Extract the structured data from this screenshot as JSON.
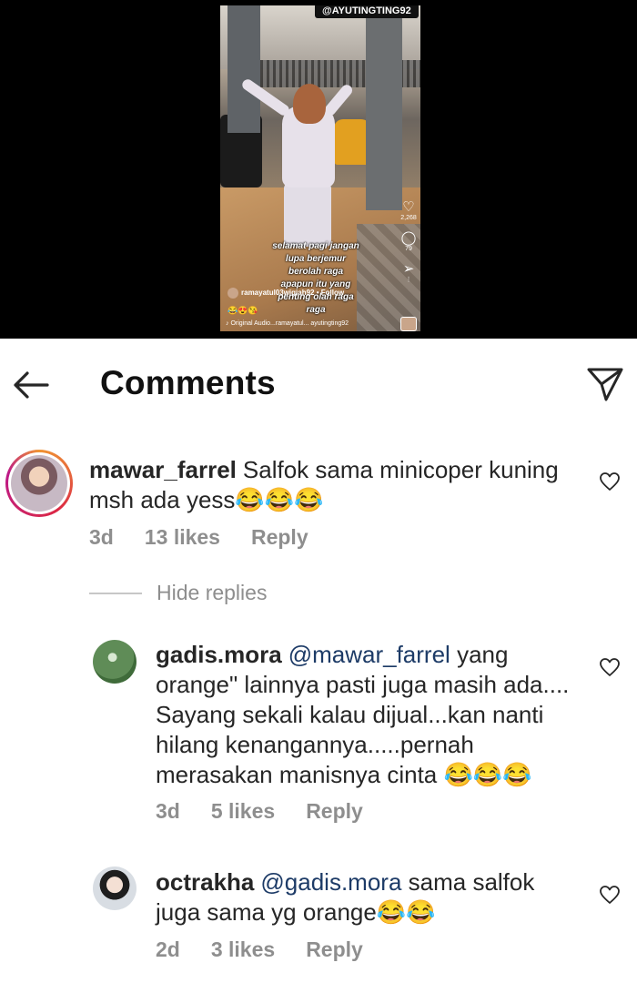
{
  "reel": {
    "handle": "@AYUTINGTING92",
    "caption_lines": [
      "selamat pagi jangan",
      "lupa berjemur",
      "berolah raga",
      "apapun itu yang",
      "penting olah raga",
      "raga"
    ],
    "like_count": "2,268",
    "comment_count": "79",
    "creator_line": "ramayatul03wigiah92 • Follow",
    "emojis": "😂😍😘",
    "audio_line": "Original Audio...ramayatul... ayutingting92"
  },
  "header": {
    "title": "Comments"
  },
  "comments": [
    {
      "username": "mawar_farrel",
      "mention": "",
      "text": "Salfok sama minicoper kuning msh ada yess😂😂😂",
      "time": "3d",
      "likes": "13 likes",
      "reply": "Reply"
    },
    {
      "username": "gadis.mora",
      "mention": "@mawar_farrel",
      "text": "yang orange\" lainnya pasti juga masih ada.... Sayang sekali kalau dijual...kan nanti hilang kenangannya.....pernah merasakan manisnya cinta 😂😂😂",
      "time": "3d",
      "likes": "5 likes",
      "reply": "Reply"
    },
    {
      "username": "octrakha",
      "mention": "@gadis.mora",
      "text": "sama salfok juga sama yg orange😂😂",
      "time": "2d",
      "likes": "3 likes",
      "reply": "Reply"
    }
  ],
  "hide_replies_label": "Hide replies",
  "icons": {
    "back": "arrow-left-icon",
    "send": "paper-plane-icon",
    "like": "heart-outline-icon"
  }
}
